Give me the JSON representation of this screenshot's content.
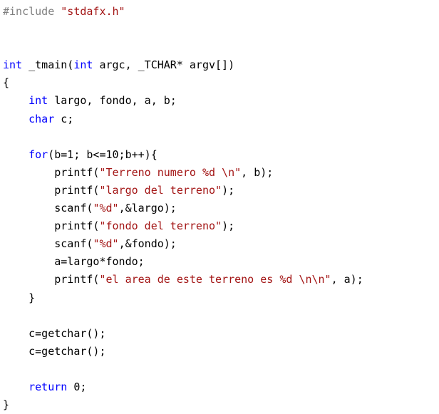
{
  "colors": {
    "keyword": "#0000ff",
    "string": "#a31515",
    "preprocessor": "#808080",
    "text": "#000000",
    "background": "#ffffff"
  },
  "code_lines": [
    [
      {
        "t": "pp",
        "v": "#include "
      },
      {
        "t": "str",
        "v": "\"stdafx.h\""
      }
    ],
    [],
    [],
    [
      {
        "t": "kw",
        "v": "int"
      },
      {
        "t": "plain",
        "v": " _tmain("
      },
      {
        "t": "kw",
        "v": "int"
      },
      {
        "t": "plain",
        "v": " argc, _TCHAR* argv[])"
      }
    ],
    [
      {
        "t": "plain",
        "v": "{"
      }
    ],
    [
      {
        "t": "plain",
        "v": "    "
      },
      {
        "t": "kw",
        "v": "int"
      },
      {
        "t": "plain",
        "v": " largo, fondo, a, b;"
      }
    ],
    [
      {
        "t": "plain",
        "v": "    "
      },
      {
        "t": "kw",
        "v": "char"
      },
      {
        "t": "plain",
        "v": " c;"
      }
    ],
    [],
    [
      {
        "t": "plain",
        "v": "    "
      },
      {
        "t": "kw",
        "v": "for"
      },
      {
        "t": "plain",
        "v": "(b=1; b<=10;b++){"
      }
    ],
    [
      {
        "t": "plain",
        "v": "        printf("
      },
      {
        "t": "str",
        "v": "\"Terreno numero %d \\n\""
      },
      {
        "t": "plain",
        "v": ", b);"
      }
    ],
    [
      {
        "t": "plain",
        "v": "        printf("
      },
      {
        "t": "str",
        "v": "\"largo del terreno\""
      },
      {
        "t": "plain",
        "v": ");"
      }
    ],
    [
      {
        "t": "plain",
        "v": "        scanf("
      },
      {
        "t": "str",
        "v": "\"%d\""
      },
      {
        "t": "plain",
        "v": ",&largo);"
      }
    ],
    [
      {
        "t": "plain",
        "v": "        printf("
      },
      {
        "t": "str",
        "v": "\"fondo del terreno\""
      },
      {
        "t": "plain",
        "v": ");"
      }
    ],
    [
      {
        "t": "plain",
        "v": "        scanf("
      },
      {
        "t": "str",
        "v": "\"%d\""
      },
      {
        "t": "plain",
        "v": ",&fondo);"
      }
    ],
    [
      {
        "t": "plain",
        "v": "        a=largo*fondo;"
      }
    ],
    [
      {
        "t": "plain",
        "v": "        printf("
      },
      {
        "t": "str",
        "v": "\"el area de este terreno es %d \\n\\n\""
      },
      {
        "t": "plain",
        "v": ", a);"
      }
    ],
    [
      {
        "t": "plain",
        "v": "    }"
      }
    ],
    [],
    [
      {
        "t": "plain",
        "v": "    c=getchar();"
      }
    ],
    [
      {
        "t": "plain",
        "v": "    c=getchar();"
      }
    ],
    [],
    [
      {
        "t": "plain",
        "v": "    "
      },
      {
        "t": "kw",
        "v": "return"
      },
      {
        "t": "plain",
        "v": " 0;"
      }
    ],
    [
      {
        "t": "plain",
        "v": "}"
      }
    ]
  ]
}
